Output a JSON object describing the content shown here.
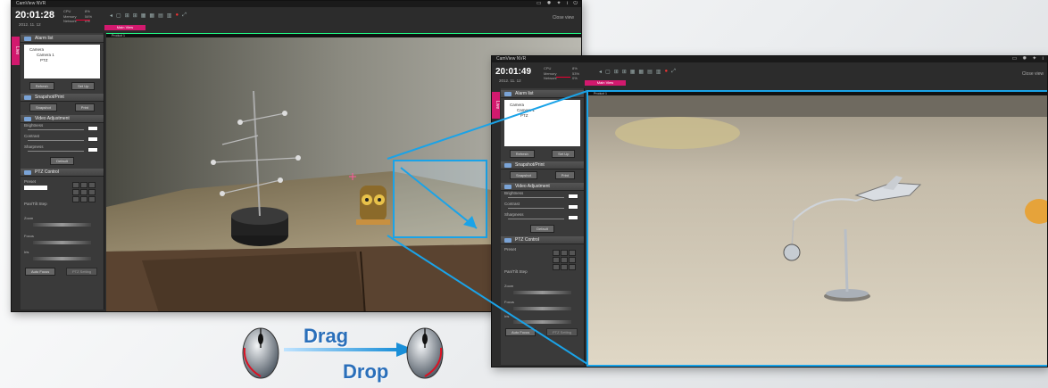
{
  "window_left": {
    "title": "CamView NVR",
    "clock": "20:01:28",
    "date": "2012. 11. 12",
    "stats": [
      {
        "label": "CPU",
        "value": "8%"
      },
      {
        "label": "Memory",
        "value": "54%"
      },
      {
        "label": "Network",
        "value": "0%"
      }
    ],
    "close_view": "Close view",
    "tab_label": "Main View",
    "side_tab": "Live",
    "video_label": "Product 1",
    "sections": {
      "alarm": "Alarm list",
      "snapshot": "Snapshot/Print",
      "video_adjust": "Video Adjustment",
      "ptz": "PTZ Control"
    },
    "tree": [
      "Camera",
      "Camera 1",
      "PTZ"
    ],
    "buttons": {
      "refresh": "Refresh",
      "set_up": "Set Up",
      "snapshot": "Snapshot",
      "print": "Print",
      "default": "Default",
      "auto_focus": "Auto Focus",
      "ptz_setting": "PTZ Setting"
    },
    "sliders": {
      "brightness": "Brightness",
      "contrast": "Contrast",
      "sharpness": "Sharpness"
    },
    "ptz_labels": {
      "preset": "Preset",
      "pan_tilt_step": "Pan/Tilt Step",
      "zoom": "Zoom",
      "focus": "Focus",
      "iris": "Iris"
    }
  },
  "window_right": {
    "title": "CamView NVR",
    "clock": "20:01:49",
    "date": "2012. 11. 12",
    "stats": [
      {
        "label": "CPU",
        "value": "8%"
      },
      {
        "label": "Memory",
        "value": "53%"
      },
      {
        "label": "Network",
        "value": "0%"
      }
    ],
    "close_view": "Close view",
    "tab_label": "Main View",
    "side_tab": "Live",
    "video_label": "Product 1"
  },
  "callout": {
    "drag": "Drag",
    "drop": "Drop"
  },
  "colors": {
    "accent_pink": "#d2196e",
    "highlight_blue": "#1aa3e8",
    "label_blue": "#2a6fba"
  },
  "icons": [
    "mouse-icon",
    "arrow-icon",
    "gear-icon",
    "close-icon"
  ]
}
